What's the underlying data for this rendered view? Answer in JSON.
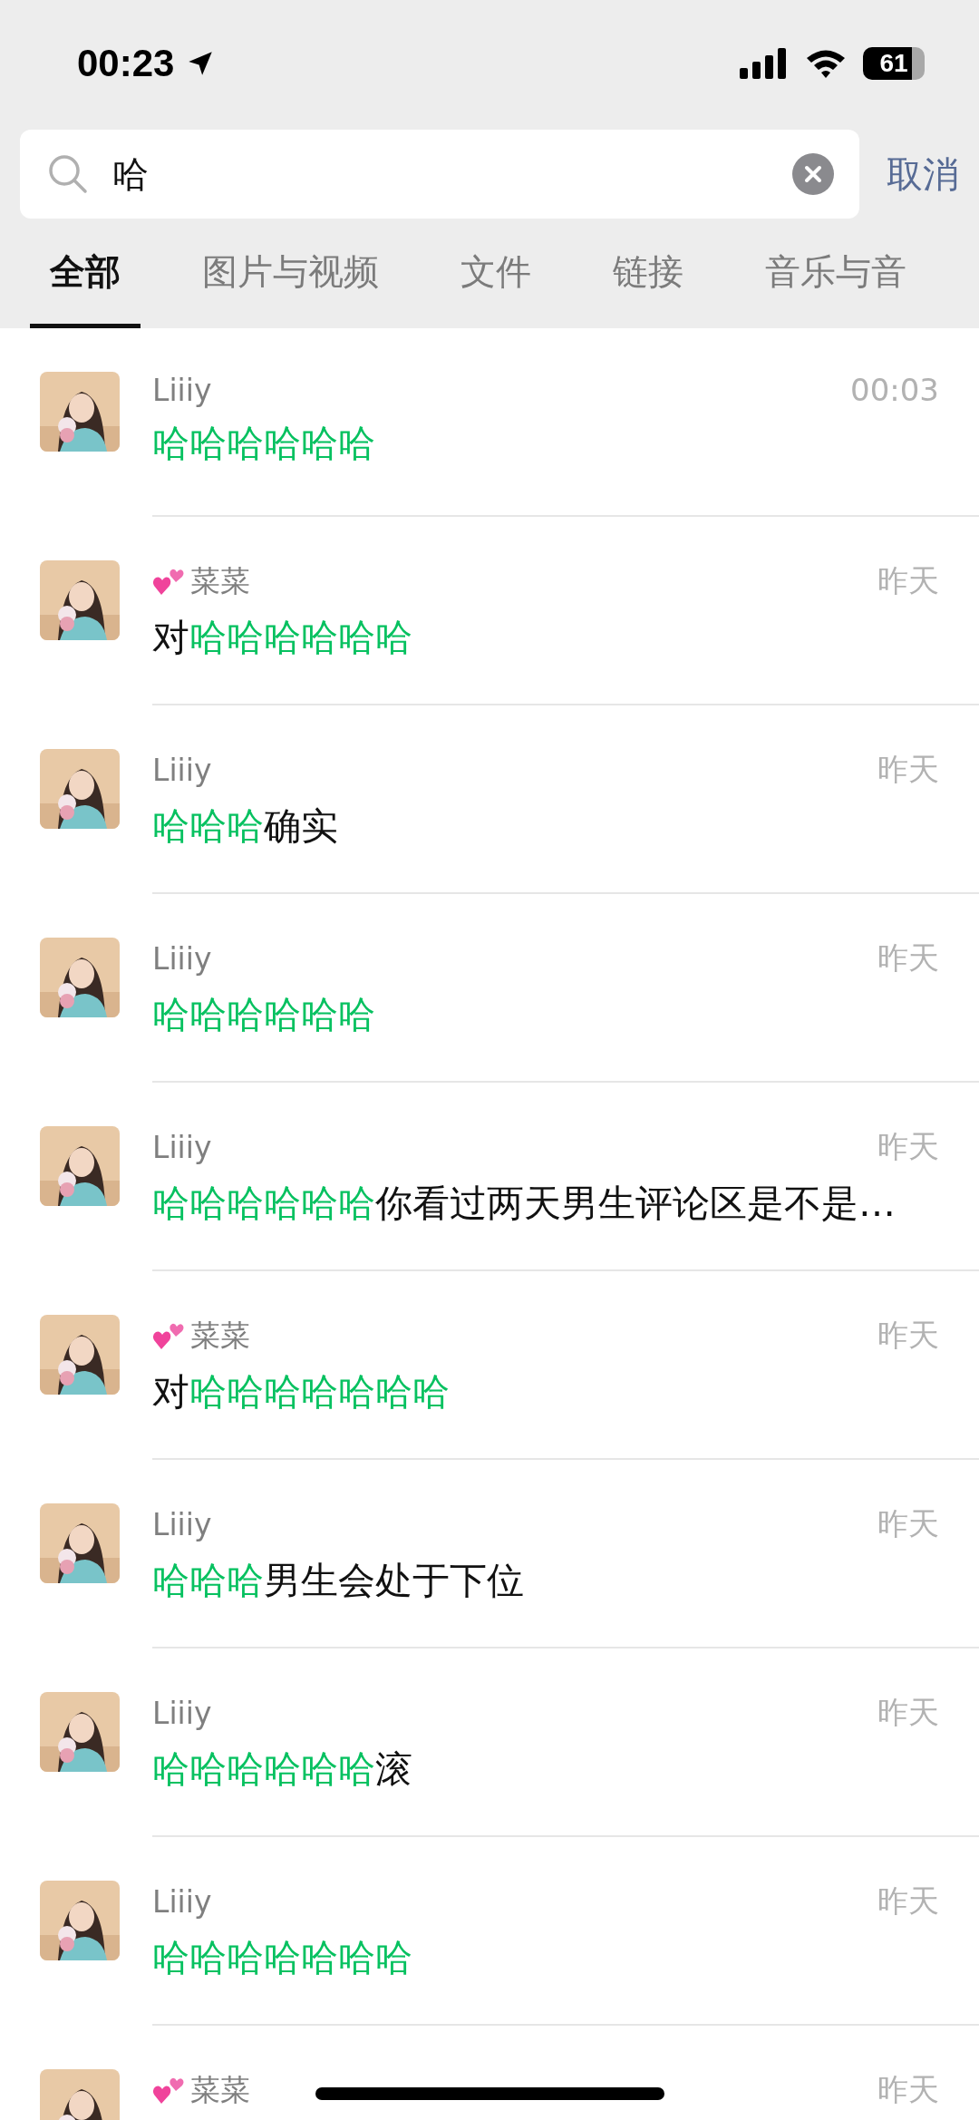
{
  "status_bar": {
    "time": "00:23",
    "battery": "61"
  },
  "search": {
    "value": "哈",
    "cancel": "取消"
  },
  "tabs": [
    {
      "label": "全部",
      "selected": true
    },
    {
      "label": "图片与视频",
      "selected": false
    },
    {
      "label": "文件",
      "selected": false
    },
    {
      "label": "链接",
      "selected": false
    },
    {
      "label": "音乐与音",
      "selected": false
    }
  ],
  "results": [
    {
      "avatar": {
        "kind": "picture"
      },
      "name": "Liiiy",
      "hearts": false,
      "time": "00:03",
      "message": [
        {
          "text": "哈哈哈哈哈哈",
          "match": true
        }
      ]
    },
    {
      "avatar": {
        "kind": "picture"
      },
      "name": "菜菜",
      "hearts": true,
      "time": "昨天",
      "message": [
        {
          "text": "对",
          "match": false
        },
        {
          "text": "哈哈哈哈哈哈",
          "match": true
        }
      ]
    },
    {
      "avatar": {
        "kind": "picture"
      },
      "name": "Liiiy",
      "hearts": false,
      "time": "昨天",
      "message": [
        {
          "text": "哈哈哈",
          "match": true
        },
        {
          "text": "确实",
          "match": false
        }
      ]
    },
    {
      "avatar": {
        "kind": "picture"
      },
      "name": "Liiiy",
      "hearts": false,
      "time": "昨天",
      "message": [
        {
          "text": "哈哈哈哈哈哈",
          "match": true
        }
      ]
    },
    {
      "avatar": {
        "kind": "picture"
      },
      "name": "Liiiy",
      "hearts": false,
      "time": "昨天",
      "message": [
        {
          "text": "哈哈哈哈哈哈",
          "match": true
        },
        {
          "text": "你看过两天男生评论区是不是…",
          "match": false
        }
      ]
    },
    {
      "avatar": {
        "kind": "picture"
      },
      "name": "菜菜",
      "hearts": true,
      "time": "昨天",
      "message": [
        {
          "text": "对",
          "match": false
        },
        {
          "text": "哈哈哈哈哈哈哈",
          "match": true
        }
      ]
    },
    {
      "avatar": {
        "kind": "picture"
      },
      "name": "Liiiy",
      "hearts": false,
      "time": "昨天",
      "message": [
        {
          "text": "哈哈哈",
          "match": true
        },
        {
          "text": "男生会处于下位",
          "match": false
        }
      ]
    },
    {
      "avatar": {
        "kind": "picture"
      },
      "name": "Liiiy",
      "hearts": false,
      "time": "昨天",
      "message": [
        {
          "text": "哈哈哈哈哈哈",
          "match": true
        },
        {
          "text": "滚",
          "match": false
        }
      ]
    },
    {
      "avatar": {
        "kind": "picture"
      },
      "name": "Liiiy",
      "hearts": false,
      "time": "昨天",
      "message": [
        {
          "text": "哈哈哈哈哈哈哈",
          "match": true
        }
      ]
    },
    {
      "avatar": {
        "kind": "picture"
      },
      "name": "菜菜",
      "hearts": true,
      "time": "昨天"
    }
  ]
}
